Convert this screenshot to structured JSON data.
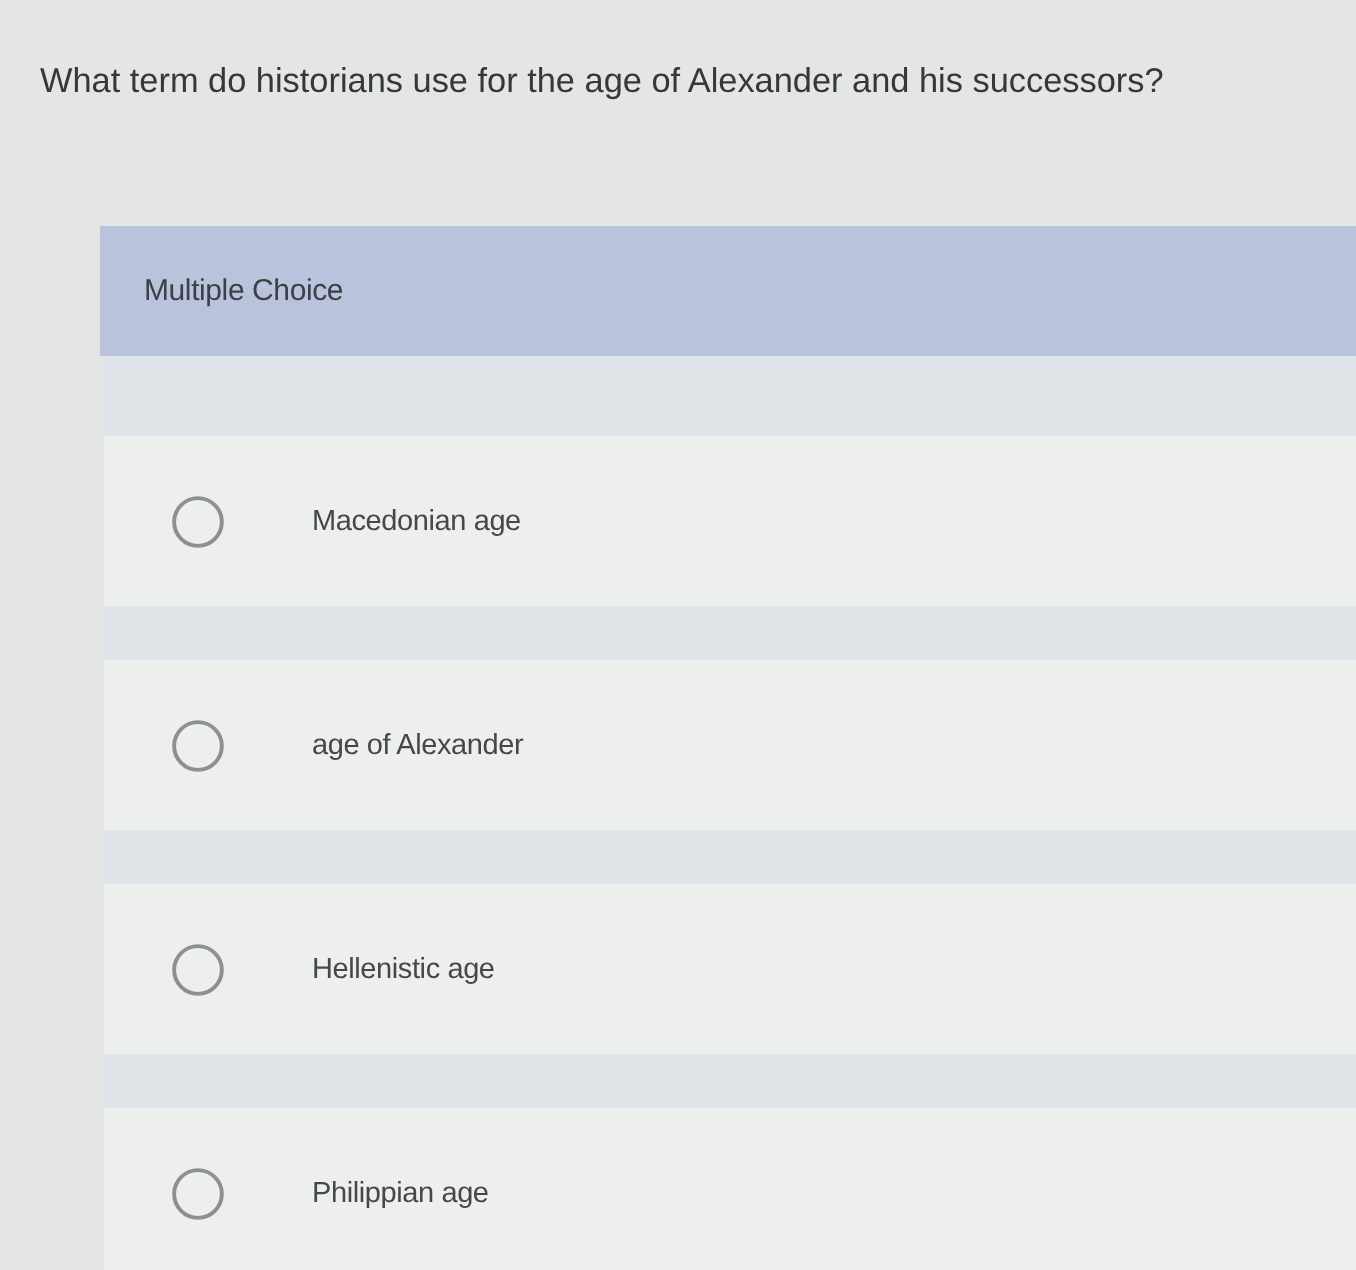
{
  "question": {
    "text": "What term do historians use for the age of Alexander and his successors?"
  },
  "answer_panel": {
    "type_label": "Multiple Choice",
    "options": [
      {
        "label": "Macedonian age",
        "selected": false
      },
      {
        "label": "age of Alexander",
        "selected": false
      },
      {
        "label": "Hellenistic age",
        "selected": false
      },
      {
        "label": "Philippian age",
        "selected": false
      }
    ]
  }
}
